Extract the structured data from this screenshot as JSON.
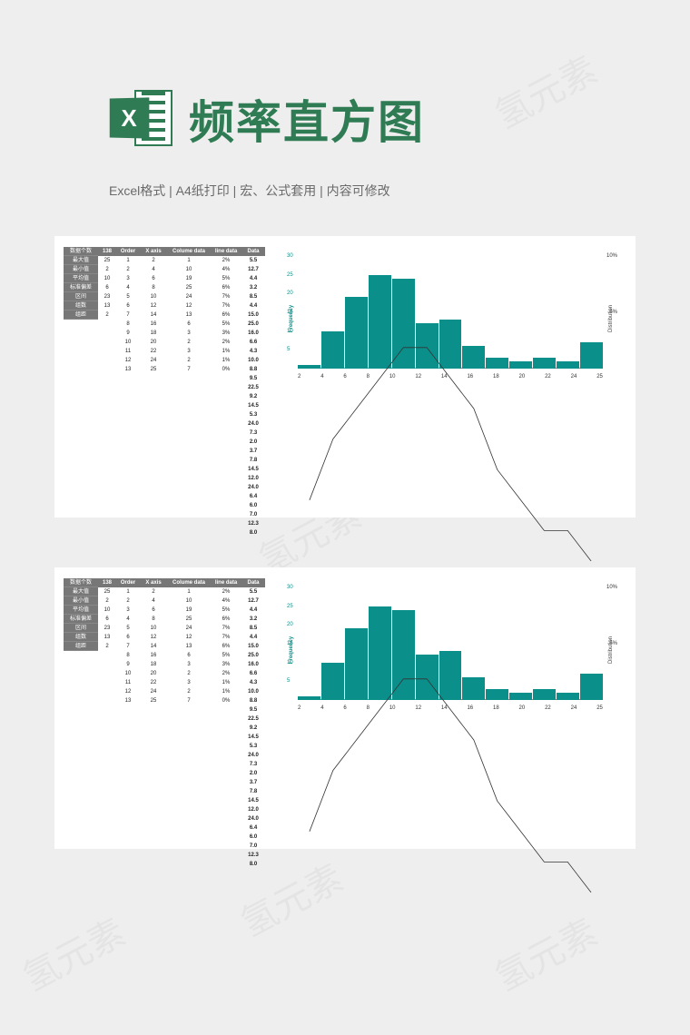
{
  "header": {
    "title": "频率直方图",
    "icon_letter": "X",
    "subtitle": "Excel格式 |  A4纸打印 | 宏、公式套用 | 内容可修改"
  },
  "watermark_text": "氢元素",
  "table": {
    "row_labels": [
      "数据个数",
      "最大值",
      "最小值",
      "平均值",
      "标准偏差",
      "区间",
      "组数",
      "组距"
    ],
    "header_138": "138",
    "col_138": [
      "25",
      "2",
      "10",
      "6",
      "23",
      "13",
      "2"
    ],
    "header_order": "Order",
    "col_order": [
      "1",
      "2",
      "3",
      "4",
      "5",
      "6",
      "7",
      "8",
      "9",
      "10",
      "11",
      "12",
      "13"
    ],
    "header_xaxis": "X axis",
    "col_xaxis": [
      "2",
      "4",
      "6",
      "8",
      "10",
      "12",
      "14",
      "16",
      "18",
      "20",
      "22",
      "24",
      "25"
    ],
    "header_colume": "Colume data",
    "col_colume": [
      "1",
      "10",
      "19",
      "25",
      "24",
      "12",
      "13",
      "6",
      "3",
      "2",
      "3",
      "2",
      "7"
    ],
    "header_line": "line data",
    "col_line": [
      "2%",
      "4%",
      "5%",
      "6%",
      "7%",
      "7%",
      "6%",
      "5%",
      "3%",
      "2%",
      "1%",
      "1%",
      "0%"
    ],
    "header_data": "Data",
    "col_data": [
      "5.5",
      "12.7",
      "4.4",
      "3.2",
      "8.5",
      "4.4",
      "15.0",
      "25.0",
      "16.0",
      "6.6",
      "4.3",
      "10.0",
      "8.8",
      "9.5",
      "22.5",
      "9.2",
      "14.5",
      "5.3",
      "24.0",
      "7.3",
      "2.0",
      "3.7",
      "7.8",
      "14.5",
      "12.0",
      "24.0",
      "6.4",
      "6.0",
      "7.0",
      "12.3",
      "8.0"
    ]
  },
  "chart_data": {
    "type": "bar",
    "categories": [
      "2",
      "4",
      "6",
      "8",
      "10",
      "12",
      "14",
      "16",
      "18",
      "20",
      "22",
      "24",
      "25"
    ],
    "values": [
      1,
      10,
      19,
      25,
      24,
      12,
      13,
      6,
      3,
      2,
      3,
      2,
      7
    ],
    "line_series": {
      "name": "Distribution",
      "values_pct": [
        2,
        4,
        5,
        6,
        7,
        7,
        6,
        5,
        3,
        2,
        1,
        1,
        0
      ]
    },
    "ylabel_left": "Frequency",
    "ylabel_right": "Distribution",
    "y_ticks_left": [
      5,
      10,
      15,
      20,
      25,
      30
    ],
    "y_ticks_right": [
      "5%",
      "10%"
    ],
    "ylim": [
      0,
      30
    ],
    "ylim_right_pct": [
      0,
      10
    ]
  }
}
